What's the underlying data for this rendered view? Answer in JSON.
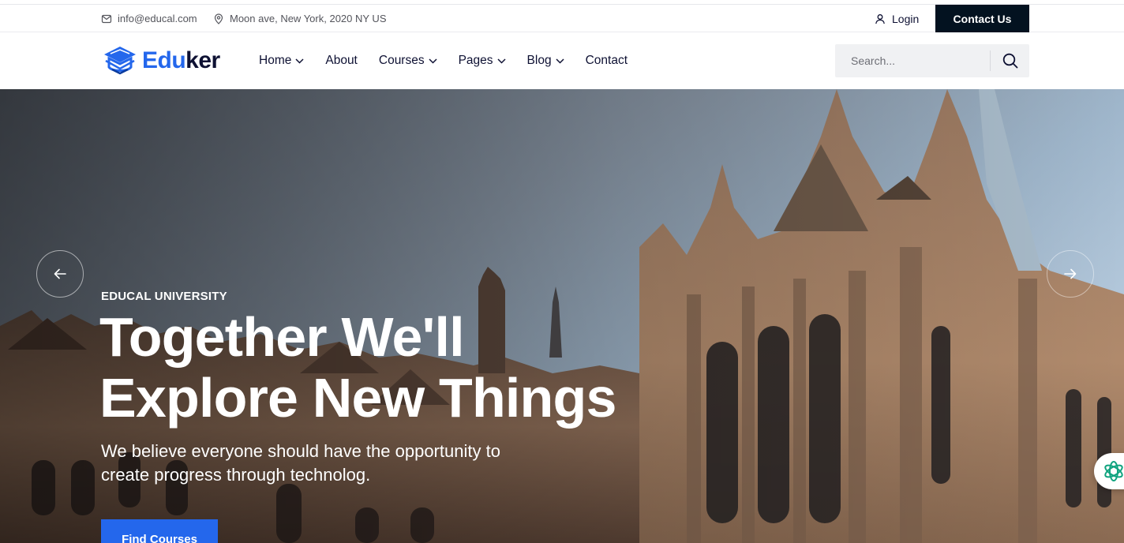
{
  "topbar": {
    "email": "info@educal.com",
    "address": "Moon ave, New York, 2020 NY US",
    "login_label": "Login",
    "contact_label": "Contact Us"
  },
  "header": {
    "logo_part1": "Edu",
    "logo_part2": "ker",
    "nav": [
      {
        "label": "Home",
        "dropdown": true
      },
      {
        "label": "About",
        "dropdown": false
      },
      {
        "label": "Courses",
        "dropdown": true
      },
      {
        "label": "Pages",
        "dropdown": true
      },
      {
        "label": "Blog",
        "dropdown": true
      },
      {
        "label": "Contact",
        "dropdown": false
      }
    ],
    "search_placeholder": "Search..."
  },
  "hero": {
    "subtitle": "EDUCAL UNIVERSITY",
    "title_line1": "Together We'll",
    "title_line2": "Explore New Things",
    "description": "We believe everyone should have the opportunity to create progress through technolog.",
    "cta_label": "Find Courses"
  },
  "icons": [
    "mail-icon",
    "location-pin-icon",
    "user-icon",
    "chevron-down-icon",
    "search-icon",
    "arrow-left-icon",
    "arrow-right-icon",
    "chat-assistant-icon"
  ],
  "colors": {
    "accent": "#2467ec",
    "dark": "#031220",
    "text": "#0e1133"
  }
}
